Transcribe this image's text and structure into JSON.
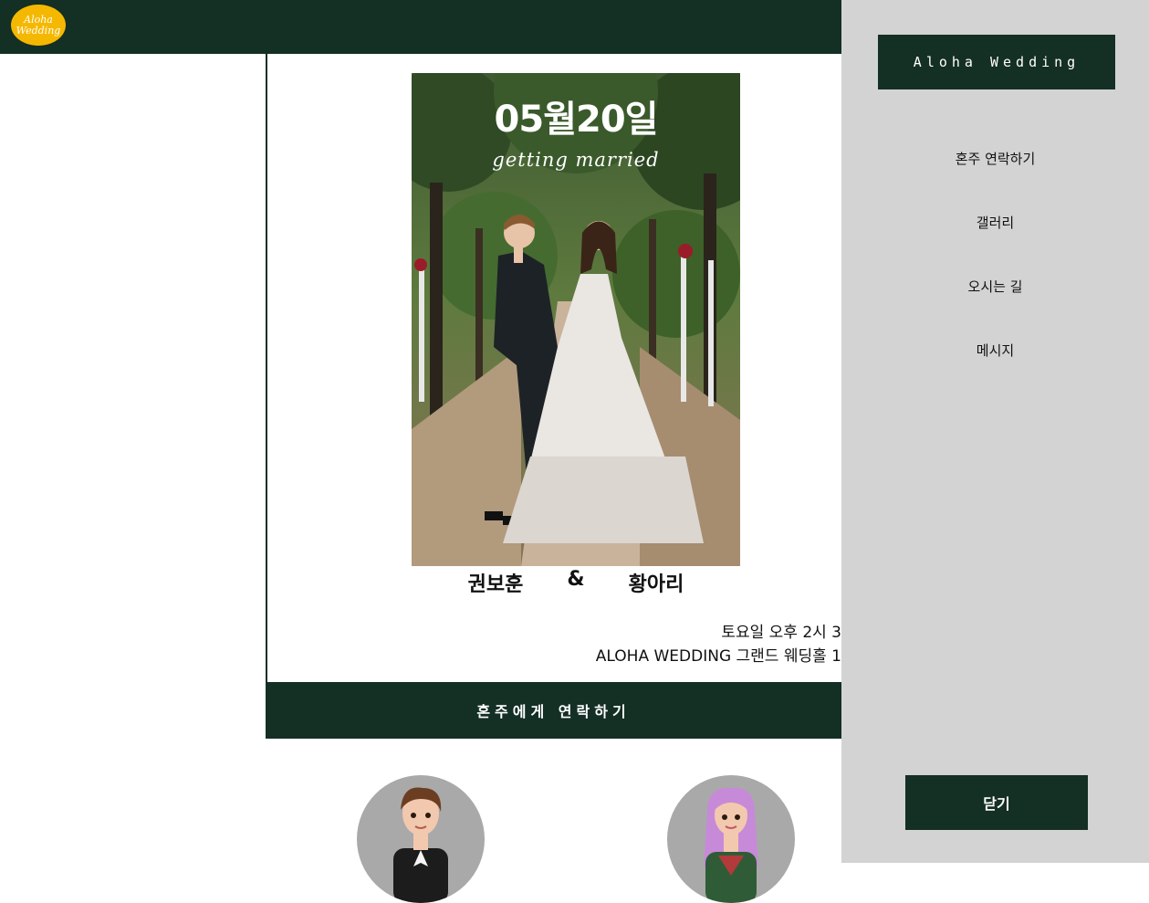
{
  "header": {
    "logo_text": "Aloha Wedding",
    "bg_color": "#142f24",
    "logo_color": "#f5b800"
  },
  "hero": {
    "date": "05월20일",
    "subtitle": "getting married"
  },
  "couple": {
    "groom": "권보훈",
    "separator": "&",
    "bride": "황아리"
  },
  "event": {
    "time": "토요일 오후 2시 3",
    "venue": "ALOHA WEDDING 그랜드 웨딩홀 1"
  },
  "contact_bar": {
    "label": "혼주에게 연락하기"
  },
  "drawer": {
    "title": "Aloha Wedding",
    "items": [
      {
        "label": "혼주 연락하기"
      },
      {
        "label": "갤러리"
      },
      {
        "label": "오시는 길"
      },
      {
        "label": "메시지"
      }
    ],
    "close_label": "닫기",
    "bg_color": "#d3d3d3"
  }
}
